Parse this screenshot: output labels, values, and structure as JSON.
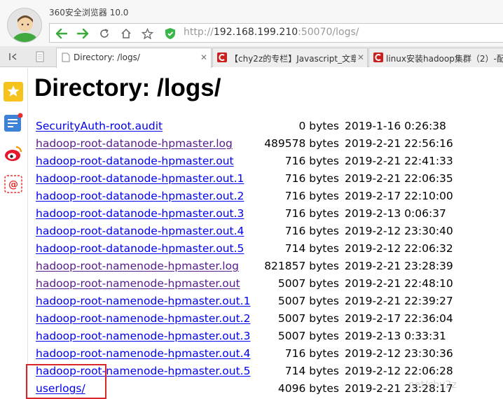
{
  "browser": {
    "app_title": "360安全浏览器 10.0",
    "url_scheme": "http://",
    "url_host": "192.168.199.210",
    "url_rest": ":50070/logs/"
  },
  "tabs": [
    {
      "label": "Directory: /logs/",
      "active": true
    },
    {
      "label": "【chy2z的专栏】Javascript_文章",
      "active": false
    },
    {
      "label": "linux安装hadoop集群（2）-配",
      "active": false
    }
  ],
  "page": {
    "heading": "Directory: /logs/",
    "files": [
      {
        "name": "SecurityAuth-root.audit",
        "size": "0 bytes",
        "date": "2019-1-16 0:26:38",
        "visited": false
      },
      {
        "name": "hadoop-root-datanode-hpmaster.log",
        "size": "489578 bytes",
        "date": "2019-2-21 22:56:16",
        "visited": true
      },
      {
        "name": "hadoop-root-datanode-hpmaster.out",
        "size": "716 bytes",
        "date": "2019-2-21 22:41:33",
        "visited": false
      },
      {
        "name": "hadoop-root-datanode-hpmaster.out.1",
        "size": "716 bytes",
        "date": "2019-2-21 22:06:35",
        "visited": false
      },
      {
        "name": "hadoop-root-datanode-hpmaster.out.2",
        "size": "716 bytes",
        "date": "2019-2-17 22:10:00",
        "visited": false
      },
      {
        "name": "hadoop-root-datanode-hpmaster.out.3",
        "size": "716 bytes",
        "date": "2019-2-13 0:06:37",
        "visited": false
      },
      {
        "name": "hadoop-root-datanode-hpmaster.out.4",
        "size": "716 bytes",
        "date": "2019-2-12 23:30:40",
        "visited": false
      },
      {
        "name": "hadoop-root-datanode-hpmaster.out.5",
        "size": "714 bytes",
        "date": "2019-2-12 22:06:32",
        "visited": false
      },
      {
        "name": "hadoop-root-namenode-hpmaster.log",
        "size": "821857 bytes",
        "date": "2019-2-21 23:28:39",
        "visited": true
      },
      {
        "name": "hadoop-root-namenode-hpmaster.out",
        "size": "5007 bytes",
        "date": "2019-2-21 22:48:10",
        "visited": true
      },
      {
        "name": "hadoop-root-namenode-hpmaster.out.1",
        "size": "5007 bytes",
        "date": "2019-2-21 22:39:27",
        "visited": false
      },
      {
        "name": "hadoop-root-namenode-hpmaster.out.2",
        "size": "5007 bytes",
        "date": "2019-2-17 22:36:04",
        "visited": false
      },
      {
        "name": "hadoop-root-namenode-hpmaster.out.3",
        "size": "5007 bytes",
        "date": "2019-2-13 0:33:31",
        "visited": false
      },
      {
        "name": "hadoop-root-namenode-hpmaster.out.4",
        "size": "716 bytes",
        "date": "2019-2-12 23:30:36",
        "visited": false
      },
      {
        "name": "hadoop-root-namenode-hpmaster.out.5",
        "size": "714 bytes",
        "date": "2019-2-12 22:06:28",
        "visited": false
      },
      {
        "name": "userlogs/",
        "size": "4096 bytes",
        "date": "2019-2-21 23:28:17",
        "visited": false
      }
    ]
  },
  "watermark": "net/chy2z",
  "colors": {
    "link": "#0000ee",
    "visited_link": "#551a8b",
    "nav_arrow": "#3aa83a",
    "highlight_box": "#d9262b",
    "shield": "#3cb64a"
  },
  "icons": {
    "back": "back-arrow-icon",
    "forward": "forward-arrow-icon",
    "reload": "reload-icon",
    "home": "home-icon",
    "favorite": "star-icon",
    "security": "shield-icon",
    "sidebar": [
      "favorites-star-icon",
      "app-grid-icon",
      "weibo-icon",
      "email-icon"
    ]
  }
}
